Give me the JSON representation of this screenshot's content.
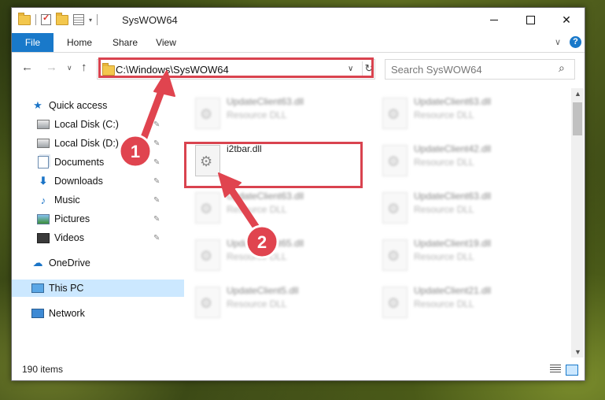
{
  "window": {
    "title": "SysWOW64",
    "minimize": "—",
    "maximize": "☐",
    "close": "✕"
  },
  "ribbon": {
    "tabs": [
      "File",
      "Home",
      "Share",
      "View"
    ],
    "chevron": "∨",
    "help": "?"
  },
  "nav": {
    "back": "←",
    "forward": "→",
    "recent": "∨",
    "up": "↑",
    "address": "C:\\Windows\\SysWOW64",
    "address_dropdown": "∨",
    "refresh": "↻",
    "search_placeholder": "Search SysWOW64",
    "search_glyph": "⌕"
  },
  "sidebar": {
    "items": [
      {
        "label": "Quick access",
        "icon": "star-icon"
      },
      {
        "label": "Local Disk (C:)",
        "icon": "disk-icon",
        "pinned": true
      },
      {
        "label": "Local Disk (D:)",
        "icon": "disk-icon",
        "pinned": true
      },
      {
        "label": "Documents",
        "icon": "documents-icon",
        "pinned": true
      },
      {
        "label": "Downloads",
        "icon": "download-icon",
        "pinned": true
      },
      {
        "label": "Music",
        "icon": "music-icon",
        "pinned": true
      },
      {
        "label": "Pictures",
        "icon": "pictures-icon",
        "pinned": true
      },
      {
        "label": "Videos",
        "icon": "videos-icon",
        "pinned": true
      },
      {
        "label": "OneDrive",
        "icon": "cloud-icon"
      },
      {
        "label": "This PC",
        "icon": "computer-icon",
        "selected": true
      },
      {
        "label": "Network",
        "icon": "network-icon"
      }
    ],
    "pin_glyph": "📌"
  },
  "files": [
    {
      "name": "UpdateClient63.dll",
      "type": "Resource DLL",
      "blurred": true
    },
    {
      "name": "UpdateClient63.dll",
      "type": "Resource DLL",
      "blurred": true
    },
    {
      "name": "i2tbar.dll",
      "type": "",
      "blurred": false,
      "highlighted": true
    },
    {
      "name": "UpdateClient42.dll",
      "type": "Resource DLL",
      "blurred": true
    },
    {
      "name": "UpdateClient63.dll",
      "type": "Resource DLL",
      "blurred": true
    },
    {
      "name": "UpdateClient63.dll",
      "type": "Resource DLL",
      "blurred": true
    },
    {
      "name": "UpdateClient65.dll",
      "type": "Resource DLL",
      "blurred": true
    },
    {
      "name": "UpdateClient19.dll",
      "type": "Resource DLL",
      "blurred": true
    },
    {
      "name": "UpdateClient5.dll",
      "type": "Resource DLL",
      "blurred": true
    },
    {
      "name": "UpdateClient21.dll",
      "type": "Resource DLL",
      "blurred": true
    }
  ],
  "status": {
    "item_count": "190 items"
  },
  "annotations": {
    "step1": "1",
    "step2": "2",
    "color": "#d9434f"
  }
}
